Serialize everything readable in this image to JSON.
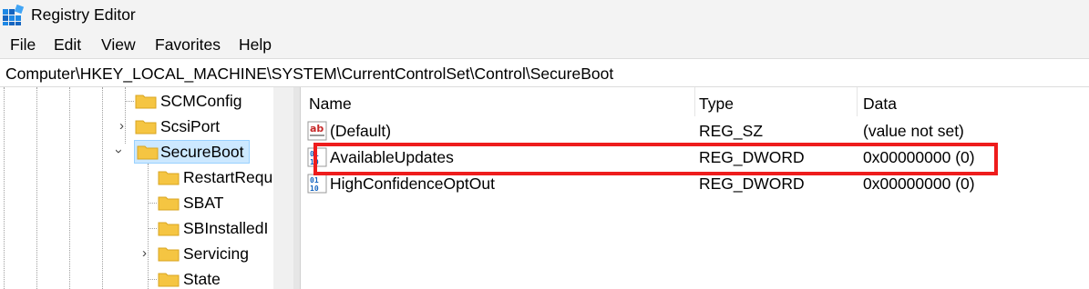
{
  "window": {
    "title": "Registry Editor"
  },
  "menu": [
    "File",
    "Edit",
    "View",
    "Favorites",
    "Help"
  ],
  "address": "Computer\\HKEY_LOCAL_MACHINE\\SYSTEM\\CurrentControlSet\\Control\\SecureBoot",
  "tree": {
    "items": [
      {
        "label": "SCMConfig",
        "expanded": false,
        "has_children": false
      },
      {
        "label": "ScsiPort",
        "expanded": false,
        "has_children": true
      },
      {
        "label": "SecureBoot",
        "expanded": true,
        "has_children": true,
        "selected": true
      },
      {
        "label": "RestartRequ",
        "child": true
      },
      {
        "label": "SBAT",
        "child": true
      },
      {
        "label": "SBInstalledI",
        "child": true
      },
      {
        "label": "Servicing",
        "child": true,
        "has_children": true
      },
      {
        "label": "State",
        "child": true
      }
    ]
  },
  "list": {
    "columns": [
      "Name",
      "Type",
      "Data"
    ],
    "rows": [
      {
        "icon": "string-value-icon",
        "name": "(Default)",
        "type": "REG_SZ",
        "data": "(value not set)"
      },
      {
        "icon": "dword-value-icon",
        "name": "AvailableUpdates",
        "type": "REG_DWORD",
        "data": "0x00000000 (0)",
        "highlighted": true
      },
      {
        "icon": "dword-value-icon",
        "name": "HighConfidenceOptOut",
        "type": "REG_DWORD",
        "data": "0x00000000 (0)"
      }
    ]
  },
  "colors": {
    "highlight_border": "#ee1c1c",
    "selection": "#cce8ff",
    "folder": "#f5c542"
  }
}
